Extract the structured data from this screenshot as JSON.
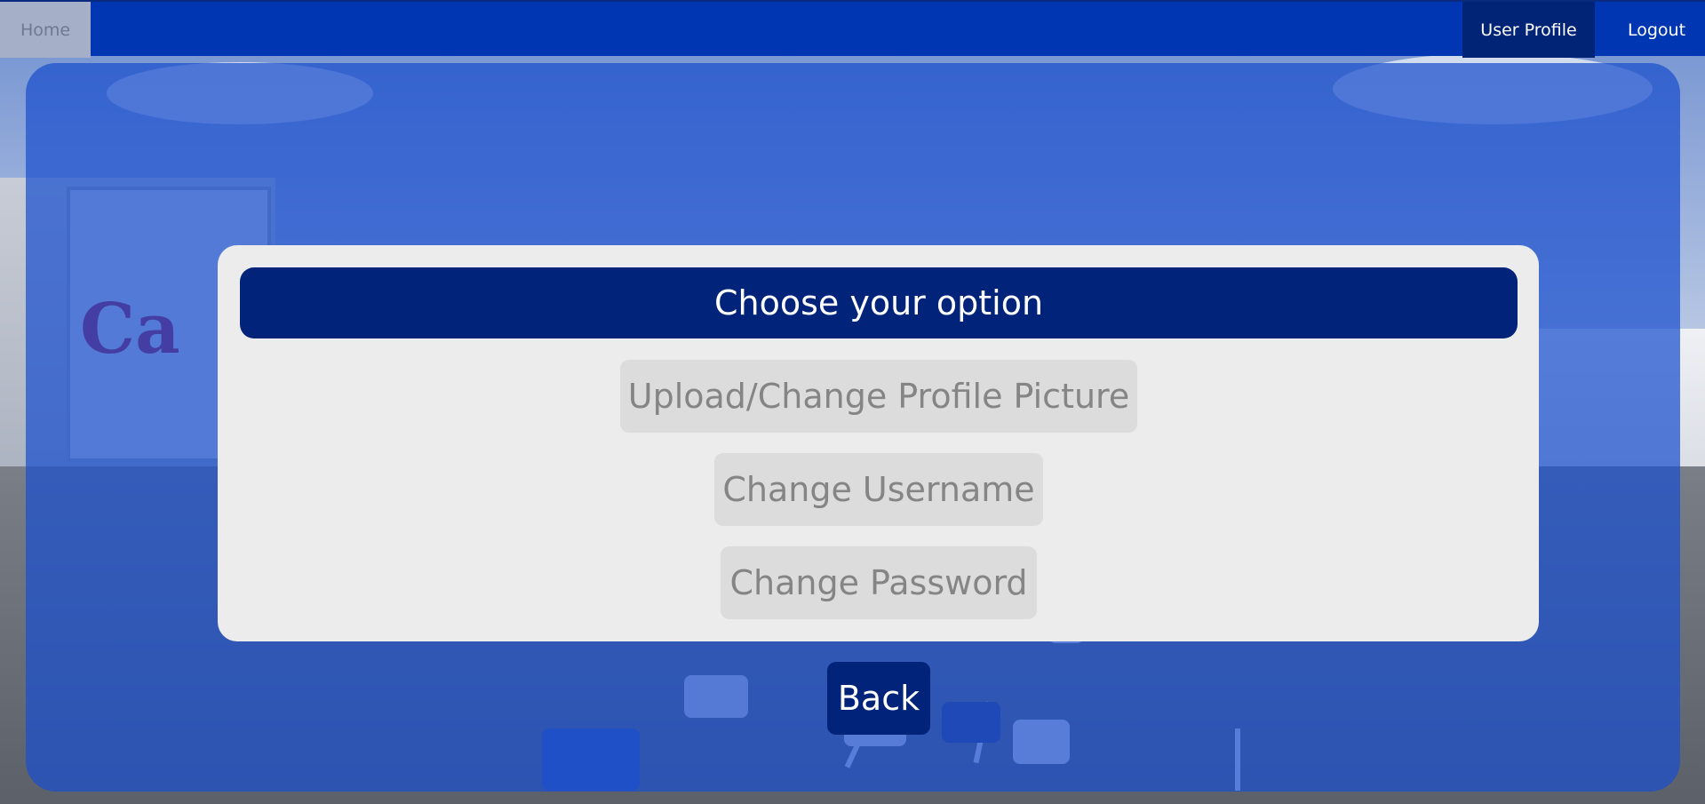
{
  "nav": {
    "home_label": "Home",
    "profile_label": "User Profile",
    "logout_label": "Logout"
  },
  "card": {
    "title": "Choose your option",
    "options": [
      {
        "label": "Upload/Change Profile Picture"
      },
      {
        "label": "Change Username"
      },
      {
        "label": "Change Password"
      }
    ]
  },
  "back_label": "Back",
  "background": {
    "billboard_text": "Ca"
  },
  "colors": {
    "navbar": "#0136b3",
    "active_nav": "#012477",
    "header": "#01237a",
    "overlay": "rgba(27,79,205,0.72)",
    "card": "#ececec",
    "option_button": "#dcdcdc"
  }
}
